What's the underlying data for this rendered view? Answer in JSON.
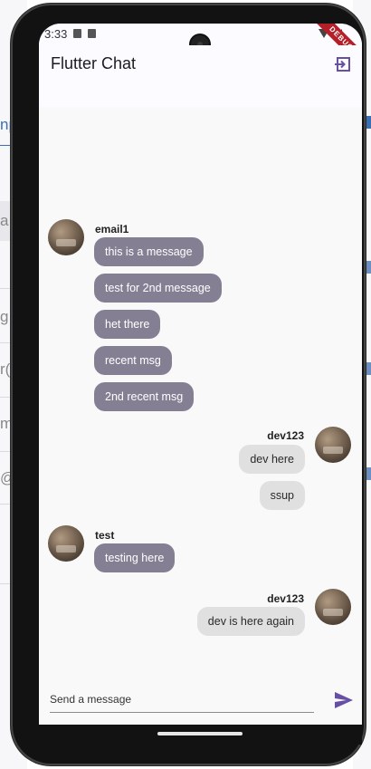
{
  "status_bar": {
    "time": "3:33"
  },
  "debug_banner": "DEBUG",
  "app_bar": {
    "title": "Flutter Chat",
    "logout_icon": "logout-icon"
  },
  "background_fragments": [
    "np",
    "a",
    "g",
    "r(",
    "m",
    "@"
  ],
  "messages": [
    {
      "user": "email1",
      "side": "other",
      "texts": [
        "this is a message",
        "test for 2nd message",
        "het there",
        "recent msg",
        "2nd recent msg"
      ]
    },
    {
      "user": "dev123",
      "side": "mine",
      "texts": [
        "dev here",
        "ssup"
      ]
    },
    {
      "user": "test",
      "side": "other",
      "texts": [
        "testing here"
      ]
    },
    {
      "user": "dev123",
      "side": "mine",
      "texts": [
        "dev is here again"
      ]
    }
  ],
  "composer": {
    "placeholder": "Send a message",
    "send_icon": "send-icon"
  },
  "colors": {
    "other_bubble": "#857f94",
    "mine_bubble": "#e0e0e0",
    "accent": "#6750a4",
    "debug": "#b51f2a"
  }
}
